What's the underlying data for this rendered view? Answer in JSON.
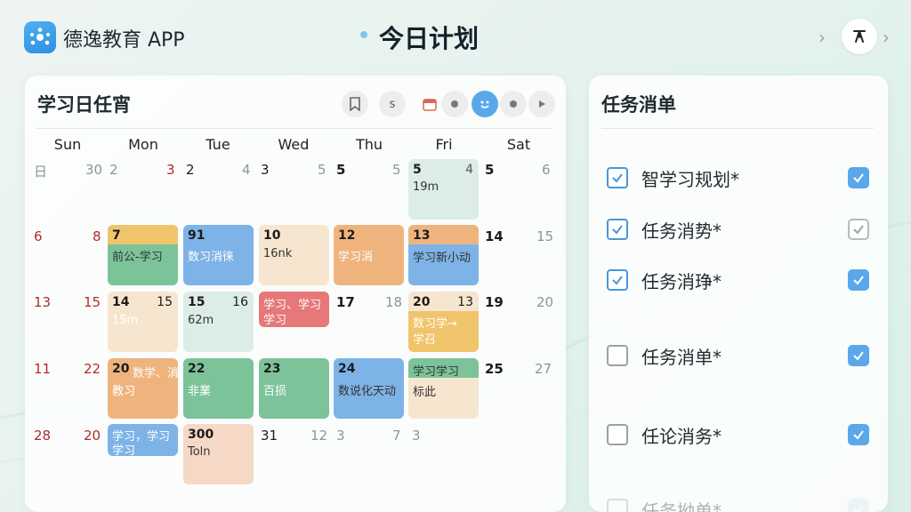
{
  "app": {
    "name": "德逸教育 APP",
    "page_title": "今日计划"
  },
  "calendar": {
    "title": "学习日任宵",
    "toolbar": [
      "s"
    ],
    "weekdays": [
      "Sun",
      "Mon",
      "Tue",
      "Wed",
      "Thu",
      "Fri",
      "Sat"
    ],
    "days": {
      "r1": [
        "日",
        "30",
        "2",
        "3",
        "2",
        "4",
        "3",
        "5",
        "5",
        "5",
        "5",
        "4",
        "5",
        "6"
      ],
      "r2": [
        "6",
        "8",
        "7",
        "91",
        "10",
        "12",
        "13",
        "14",
        "15"
      ],
      "r3": [
        "13",
        "15",
        "14",
        "15",
        "15",
        "16",
        "17",
        "18",
        "20",
        "13",
        "19",
        "20"
      ],
      "r4": [
        "11",
        "22",
        "20",
        "22",
        "23",
        "24",
        "25",
        "27"
      ],
      "r5": [
        "28",
        "20",
        "300",
        "31",
        "12",
        "3",
        "7",
        "3"
      ]
    },
    "events": {
      "fri1": "19m",
      "mon2": "前公-学习",
      "tue2": "数习消徕",
      "wed2": "16nk",
      "thu2": "学习消",
      "fri2": "学习新小动",
      "mon3": "15m",
      "tue3": "62m",
      "wed3_a": "学习、学习",
      "wed3_b": "学习",
      "fri3_a": "数习学→",
      "fri3_b": "学召",
      "mon4_a": "数学、消",
      "mon4_b": "教习",
      "tue4": "非業",
      "wed4": "百损",
      "thu4": "数说化天动",
      "fri4_a": "学习学习",
      "fri4_b": "标此",
      "mon5_a": "学习，学习",
      "mon5_b": "学习",
      "tue5": "Toln"
    }
  },
  "tasks": {
    "title": "任务消单",
    "items": [
      {
        "label": "智学习规划*",
        "checked": true,
        "right": "checked"
      },
      {
        "label": "任务消势*",
        "checked": true,
        "right": "outline"
      },
      {
        "label": "任务消琤*",
        "checked": true,
        "right": "checked"
      },
      {
        "label": "任务消单*",
        "checked": false,
        "right": "checked"
      },
      {
        "label": "任论消务*",
        "checked": false,
        "right": "checked"
      },
      {
        "label": "任务拗单*",
        "checked": false,
        "right": "faded"
      }
    ]
  },
  "colors": {
    "accent": "#5aa8ea",
    "event_green": "#7cc39a",
    "event_blue": "#7db3e6",
    "event_orange": "#efb47e",
    "event_red": "#e6787a",
    "event_yellow": "#f0c46a",
    "event_beige": "#f6e6cf",
    "event_mint": "#dcede7",
    "event_peach": "#f6d8c6"
  },
  "icons": [
    "logo-icon",
    "chevron-left-icon",
    "user-icon",
    "chevron-right-icon",
    "calendar-icon",
    "bookmark-icon",
    "smiley-icon",
    "dot-icon",
    "play-icon",
    "check-icon"
  ]
}
